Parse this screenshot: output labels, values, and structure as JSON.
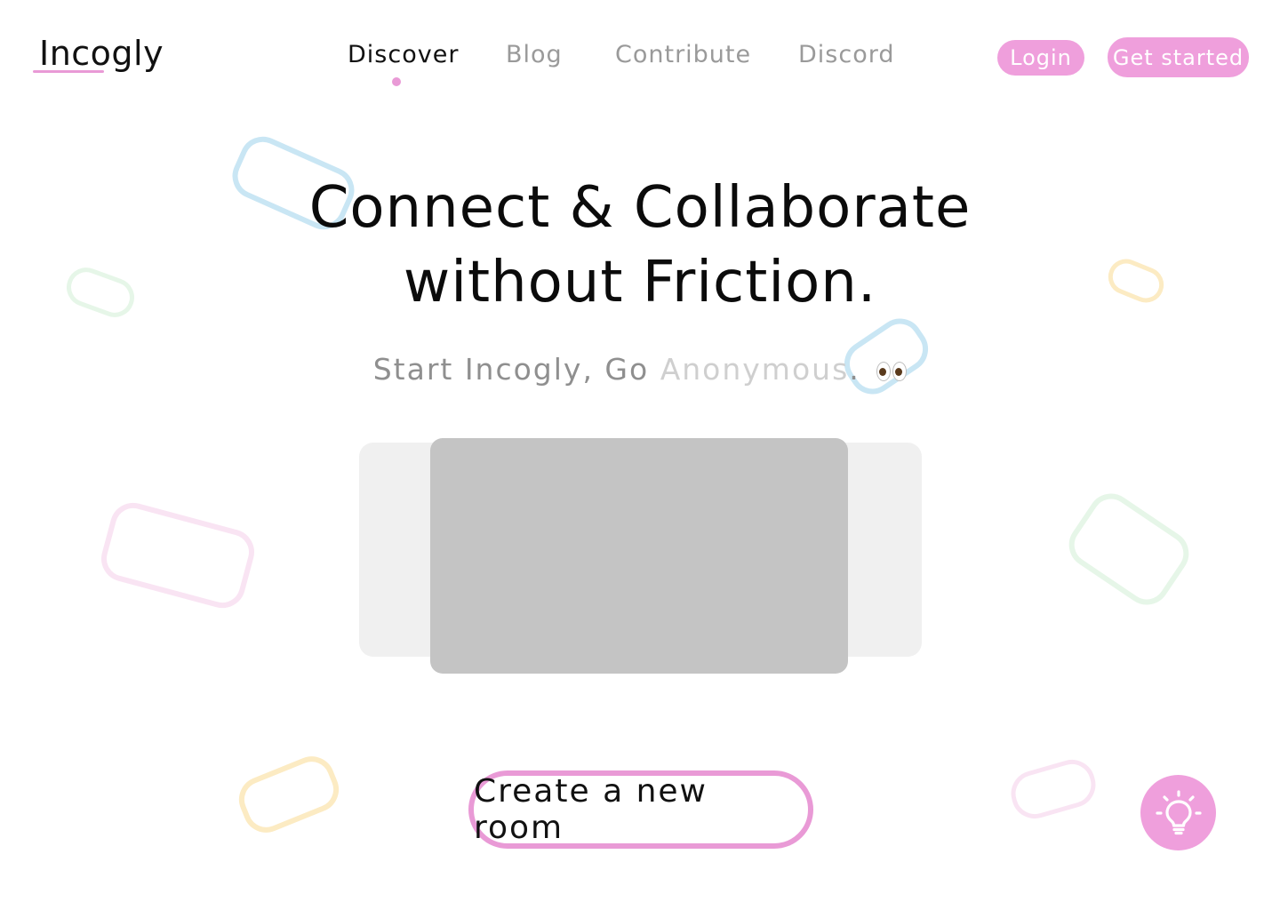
{
  "brand": {
    "name": "Incogly",
    "accent": "#ef9fdc"
  },
  "nav": {
    "items": [
      {
        "label": "Discover",
        "active": true
      },
      {
        "label": "Blog",
        "active": false
      },
      {
        "label": "Contribute",
        "active": false
      },
      {
        "label": "Discord",
        "active": false
      }
    ]
  },
  "header": {
    "login_label": "Login",
    "get_started_label": "Get started"
  },
  "hero": {
    "title_line1": "Connect & Collaborate",
    "title_line2": "without Friction.",
    "subtitle_prefix": "Start Incogly, Go ",
    "subtitle_faded": "Anonymous",
    "subtitle_suffix": "."
  },
  "cta": {
    "label": "Create a new room"
  },
  "fab": {
    "icon": "lightbulb-icon"
  },
  "decor_colors": {
    "blue": "#c9e6f4",
    "green": "#e6f6e8",
    "yellow": "#fcebc3",
    "pink": "#f9e4f3"
  }
}
